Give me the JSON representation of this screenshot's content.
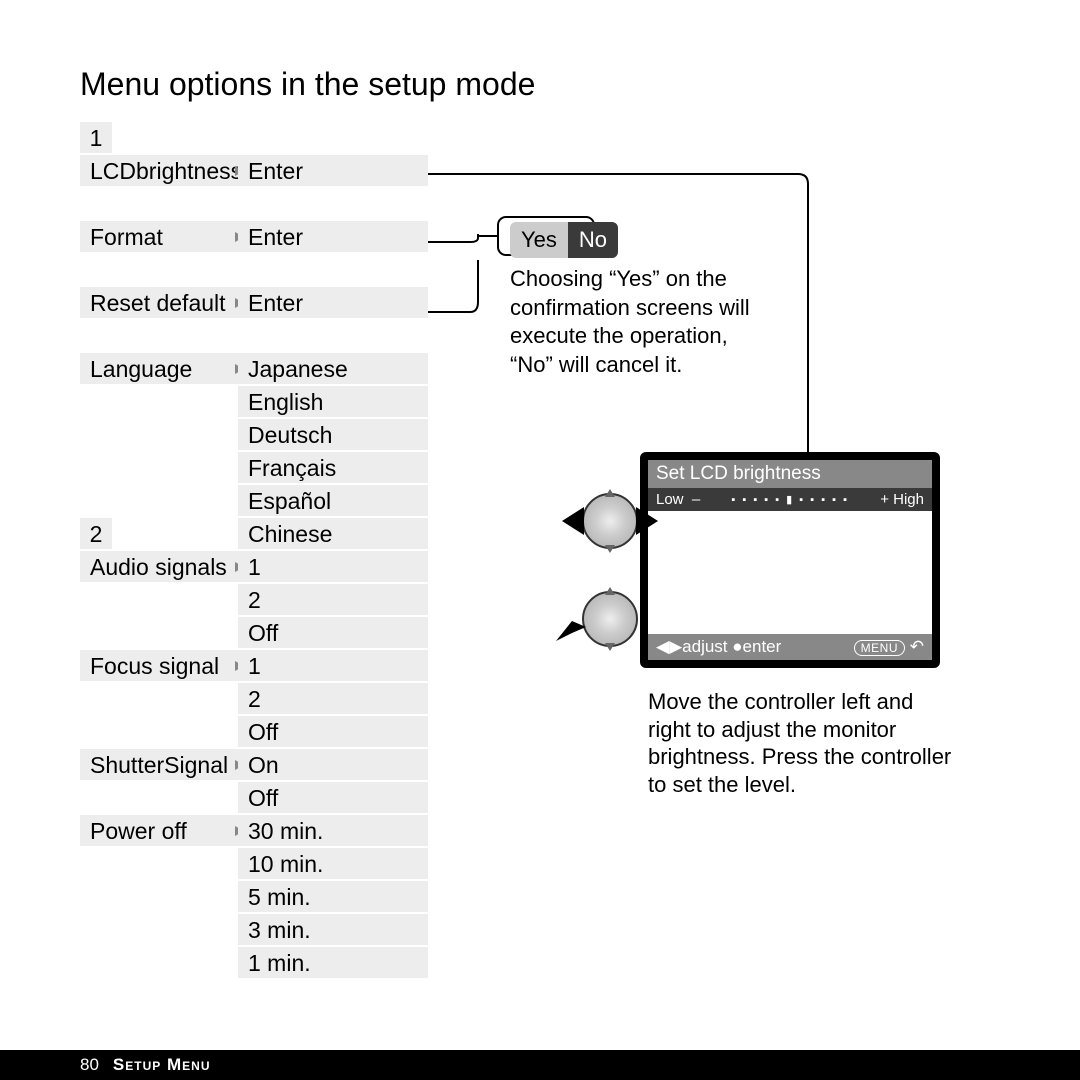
{
  "title": "Menu options in the setup mode",
  "footer": {
    "page": "80",
    "section": "Setup Menu"
  },
  "tabs": {
    "t1": "1",
    "t2": "2"
  },
  "menu1": {
    "lcdbrightness": "LCDbrightness",
    "format": "Format",
    "resetdefault": "Reset default",
    "language": "Language"
  },
  "menu2": {
    "audiosignals": "Audio signals",
    "focussignal": "Focus signal",
    "shuttersignal": "ShutterSignal",
    "poweroff": "Power off"
  },
  "opts": {
    "enter1": "Enter",
    "enter2": "Enter",
    "enter3": "Enter",
    "lang": {
      "jp": "Japanese",
      "en": "English",
      "de": "Deutsch",
      "fr": "Français",
      "es": "Español",
      "cn": "Chinese"
    },
    "audio": {
      "v1": "1",
      "v2": "2",
      "off": "Off"
    },
    "focus": {
      "v1": "1",
      "v2": "2",
      "off": "Off"
    },
    "shutter": {
      "on": "On",
      "off": "Off"
    },
    "power": {
      "p30": "30 min.",
      "p10": "10 min.",
      "p5": "5 min.",
      "p3": "3 min.",
      "p1": "1 min."
    }
  },
  "yesno": {
    "yes": "Yes",
    "no": "No"
  },
  "note1": "Choosing “Yes” on the confirmation screens will execute the operation, “No” will cancel it.",
  "note2": "Move the controller left and right to adjust the monitor brightness. Press the controller to set the level.",
  "lcd": {
    "title": "Set LCD brightness",
    "low": "Low",
    "high": "High",
    "adjust": "adjust",
    "enter": "enter",
    "menu": "MENU"
  }
}
